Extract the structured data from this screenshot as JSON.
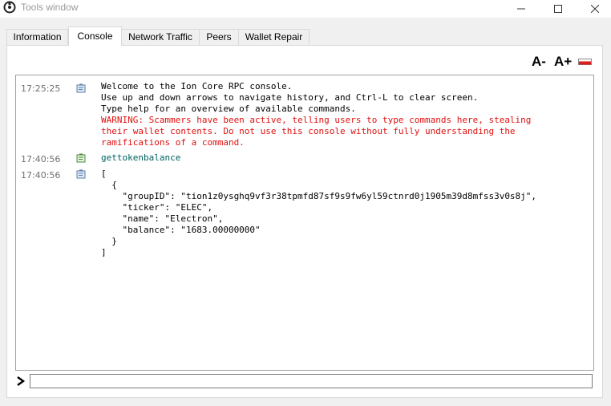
{
  "window": {
    "title": "Tools window"
  },
  "tabs": [
    "Information",
    "Console",
    "Network Traffic",
    "Peers",
    "Wallet Repair"
  ],
  "toolbar": {
    "font_decrease": "A-",
    "font_increase": "A+"
  },
  "console": {
    "entries": [
      {
        "time": "17:25:25",
        "kind": "reply",
        "lines": [
          "Welcome to the Ion Core RPC console.",
          "Use up and down arrows to navigate history, and Ctrl-L to clear screen.",
          "Type help for an overview of available commands."
        ],
        "warning": [
          "WARNING: Scammers have been active, telling users to type commands here, stealing",
          "their wallet contents. Do not use this console without fully understanding the",
          "ramifications of a command."
        ]
      },
      {
        "time": "17:40:56",
        "kind": "command",
        "lines": [
          "gettokenbalance"
        ]
      },
      {
        "time": "17:40:56",
        "kind": "reply",
        "lines": [
          "[",
          "  {",
          "    \"groupID\": \"tion1z0ysghq9vf3r38tpmfd87sf9s9fw6yl59ctnrd0j1905m39d8mfss3v0s8j\",",
          "    \"ticker\": \"ELEC\",",
          "    \"name\": \"Electron\",",
          "    \"balance\": \"1683.00000000\"",
          "  }",
          "]"
        ]
      }
    ]
  },
  "input": {
    "value": "",
    "prompt_symbol": ">"
  }
}
